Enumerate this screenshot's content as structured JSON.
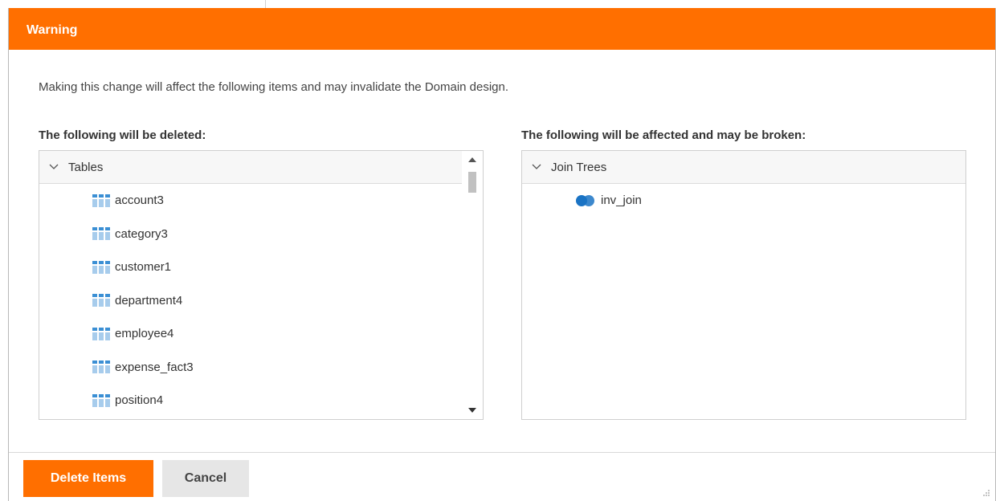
{
  "dialog": {
    "title": "Warning",
    "message": "Making this change will affect the following items and may invalidate the Domain design."
  },
  "deleted": {
    "heading": "The following will be deleted:",
    "group_label": "Tables",
    "items": [
      "account3",
      "category3",
      "customer1",
      "department4",
      "employee4",
      "expense_fact3",
      "position4"
    ]
  },
  "affected": {
    "heading": "The following will be affected and may be broken:",
    "group_label": "Join Trees",
    "items": [
      "inv_join"
    ]
  },
  "buttons": {
    "delete_label": "Delete Items",
    "cancel_label": "Cancel"
  },
  "icons": {
    "group_toggle": "chevron-down-icon",
    "table": "table-icon",
    "join": "join-icon",
    "scroll_up": "scroll-up-arrow-icon",
    "scroll_down": "scroll-down-arrow-icon",
    "resize": "resize-grip-icon"
  },
  "colors": {
    "accent": "#ff6f00",
    "table_icon": "#3b8fd4",
    "join_icon": "#1a73c4"
  }
}
